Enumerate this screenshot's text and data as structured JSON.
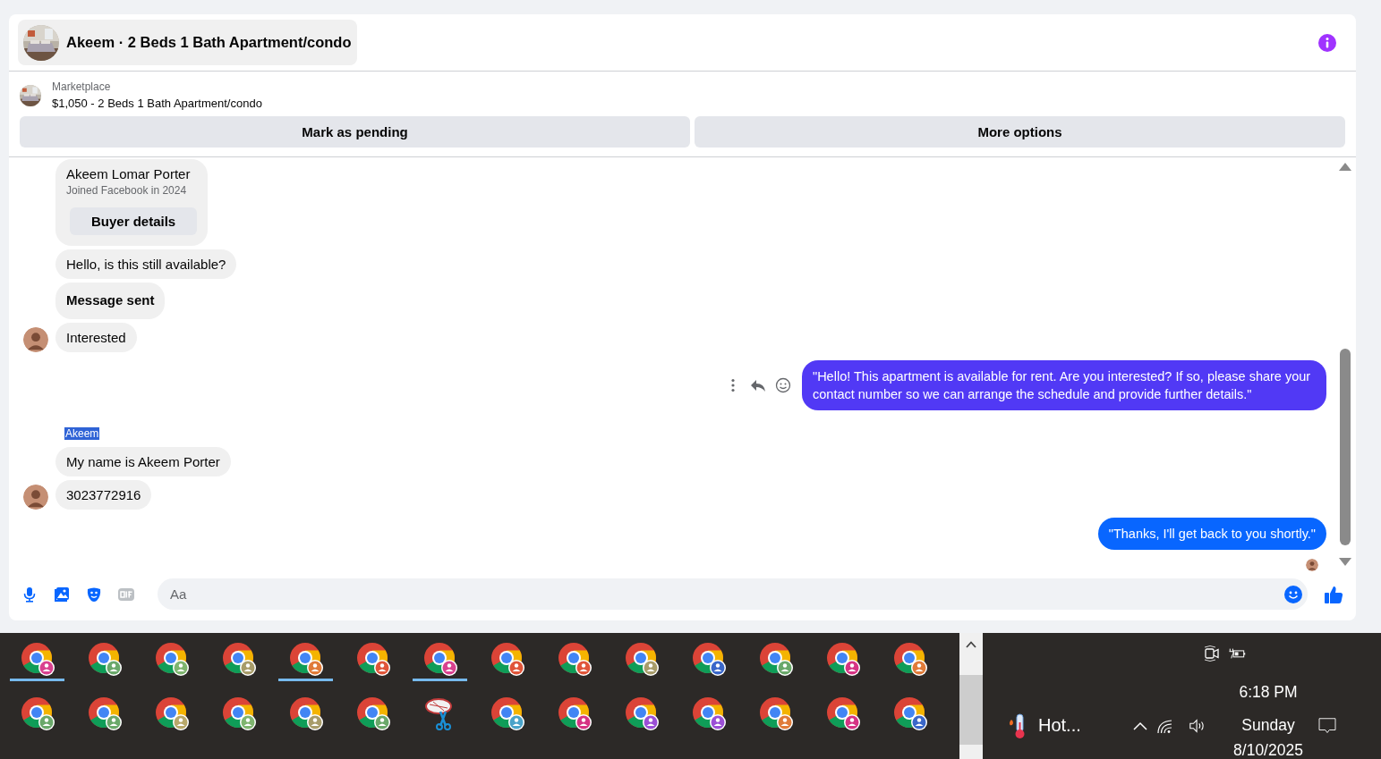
{
  "header": {
    "title": "Akeem · 2 Beds 1 Bath Apartment/condo"
  },
  "listing": {
    "source": "Marketplace",
    "summary": "$1,050 - 2 Beds 1 Bath Apartment/condo"
  },
  "actions": [
    "Mark as pending",
    "More options"
  ],
  "messages": [
    {
      "kind": "profile_card",
      "name": "Akeem Lomar Porter",
      "joined": "Joined Facebook in 2024",
      "button": "Buyer details"
    },
    {
      "kind": "incoming",
      "text": "Hello, is this still available?",
      "bold": false,
      "avatar": false
    },
    {
      "kind": "incoming",
      "text": "Message sent",
      "bold": true,
      "avatar": false
    },
    {
      "kind": "incoming",
      "text": "Interested",
      "bold": false,
      "avatar": true
    },
    {
      "kind": "outgoing",
      "text": "\"Hello! This apartment is available for rent. Are you interested? If so, please share your contact number so we can arrange the schedule and provide further details.\"",
      "color": "#5139f5",
      "hover_actions": true,
      "seen": false
    },
    {
      "kind": "sender_label",
      "text": "Akeem",
      "selected": true
    },
    {
      "kind": "incoming",
      "text": "My name is Akeem Porter",
      "bold": false,
      "avatar": false
    },
    {
      "kind": "incoming",
      "text": "3023772916",
      "bold": false,
      "avatar": true
    },
    {
      "kind": "outgoing",
      "text": "\"Thanks, I'll get back to you shortly.\"",
      "color": "#0866ff",
      "hover_actions": false,
      "seen": true
    }
  ],
  "composer": {
    "placeholder": "Aa"
  },
  "taskbar": {
    "apps": [
      {
        "kind": "browser",
        "color": "#d9418f",
        "active": true
      },
      {
        "kind": "browser",
        "color": "#6aa86a",
        "active": false
      },
      {
        "kind": "browser",
        "color": "#7fb56f",
        "active": false
      },
      {
        "kind": "browser",
        "color": "#a89c6a",
        "active": false
      },
      {
        "kind": "browser",
        "color": "#e07b39",
        "active": true
      },
      {
        "kind": "browser",
        "color": "#e0553a",
        "active": false
      },
      {
        "kind": "browser",
        "color": "#d9418f",
        "active": true
      },
      {
        "kind": "browser",
        "color": "#e0553a",
        "active": false
      },
      {
        "kind": "browser",
        "color": "#e0553a",
        "active": false
      },
      {
        "kind": "browser",
        "color": "#a89c6a",
        "active": false
      },
      {
        "kind": "browser",
        "color": "#3a67c9",
        "active": false
      },
      {
        "kind": "browser",
        "color": "#6aa86a",
        "active": false
      },
      {
        "kind": "browser",
        "color": "#d63384",
        "active": false
      },
      {
        "kind": "browser",
        "color": "#e07b39",
        "active": false
      },
      {
        "kind": "browser",
        "color": "#6aa86a",
        "active": false
      },
      {
        "kind": "browser",
        "color": "#6aa86a",
        "active": false
      },
      {
        "kind": "browser",
        "color": "#b8a86a",
        "active": false
      },
      {
        "kind": "browser",
        "color": "#7fb56f",
        "active": false
      },
      {
        "kind": "browser",
        "color": "#a89c6a",
        "active": false
      },
      {
        "kind": "browser",
        "color": "#6aa86a",
        "active": false
      },
      {
        "kind": "snipping",
        "active": false
      },
      {
        "kind": "browser",
        "color": "#4aa3c9",
        "active": false
      },
      {
        "kind": "browser",
        "color": "#d63384",
        "active": false
      },
      {
        "kind": "browser",
        "color": "#9b4fd6",
        "active": false
      },
      {
        "kind": "browser",
        "color": "#9b4fd6",
        "active": false
      },
      {
        "kind": "browser",
        "color": "#e07b39",
        "active": false
      },
      {
        "kind": "browser",
        "color": "#d63384",
        "active": false
      },
      {
        "kind": "browser",
        "color": "#3a67c9",
        "active": false
      }
    ],
    "weather": "Hot...",
    "time": "6:18 PM",
    "day": "Sunday",
    "date": "8/10/2025"
  }
}
